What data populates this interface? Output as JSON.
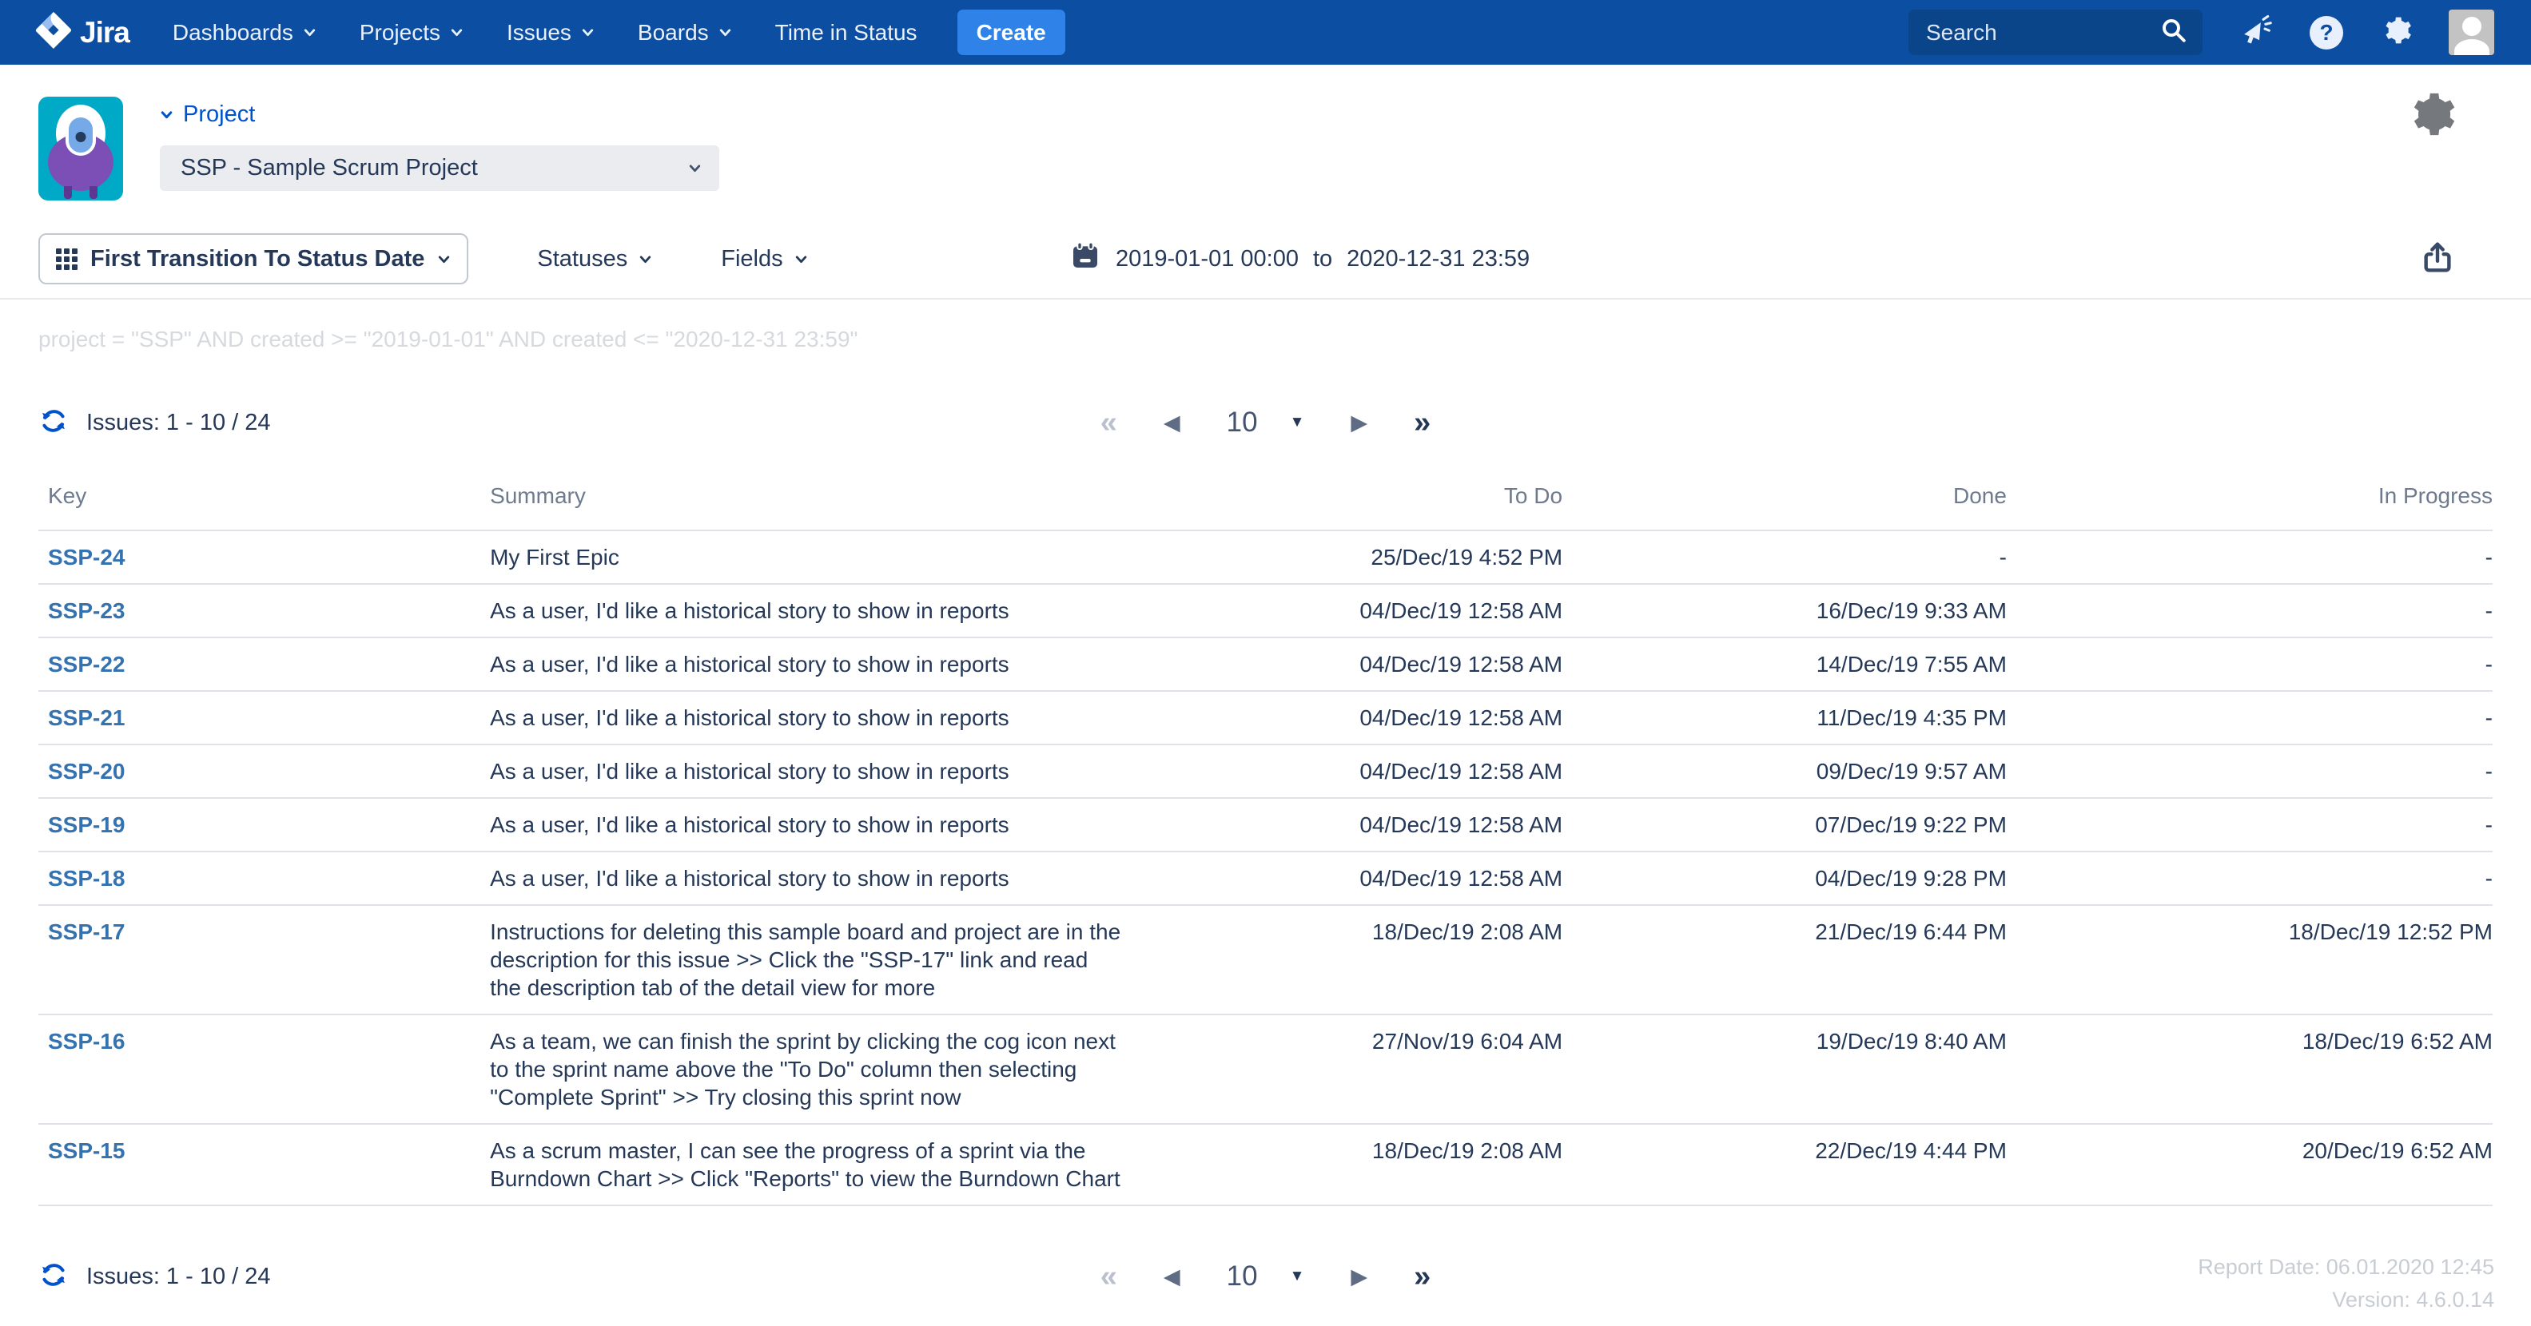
{
  "nav": {
    "brand": "Jira",
    "items": [
      {
        "label": "Dashboards"
      },
      {
        "label": "Projects"
      },
      {
        "label": "Issues"
      },
      {
        "label": "Boards"
      },
      {
        "label": "Time in Status"
      }
    ],
    "create_label": "Create",
    "search_placeholder": "Search"
  },
  "project": {
    "label": "Project",
    "selected": "SSP - Sample Scrum Project"
  },
  "toolbar": {
    "report_type": "First Transition To Status Date",
    "statuses": "Statuses",
    "fields": "Fields",
    "date_from": "2019-01-01 00:00",
    "to_word": "to",
    "date_to": "2020-12-31 23:59"
  },
  "jql": "project = \"SSP\" AND created >= \"2019-01-01\" AND created <= \"2020-12-31 23:59\"",
  "issues_bar": {
    "summary": "Issues: 1 - 10 / 24"
  },
  "pagination": {
    "page_size": "10",
    "first": "«",
    "prev": "◀",
    "next": "▶",
    "last": "»",
    "caret": "▼"
  },
  "table": {
    "columns": [
      "Key",
      "Summary",
      "To Do",
      "Done",
      "In Progress"
    ],
    "rows": [
      {
        "key": "SSP-24",
        "summary": "My First Epic",
        "todo": "25/Dec/19 4:52 PM",
        "done": "-",
        "in_progress": "-"
      },
      {
        "key": "SSP-23",
        "summary": "As a user, I'd like a historical story to show in reports",
        "todo": "04/Dec/19 12:58 AM",
        "done": "16/Dec/19 9:33 AM",
        "in_progress": "-"
      },
      {
        "key": "SSP-22",
        "summary": "As a user, I'd like a historical story to show in reports",
        "todo": "04/Dec/19 12:58 AM",
        "done": "14/Dec/19 7:55 AM",
        "in_progress": "-"
      },
      {
        "key": "SSP-21",
        "summary": "As a user, I'd like a historical story to show in reports",
        "todo": "04/Dec/19 12:58 AM",
        "done": "11/Dec/19 4:35 PM",
        "in_progress": "-"
      },
      {
        "key": "SSP-20",
        "summary": "As a user, I'd like a historical story to show in reports",
        "todo": "04/Dec/19 12:58 AM",
        "done": "09/Dec/19 9:57 AM",
        "in_progress": "-"
      },
      {
        "key": "SSP-19",
        "summary": "As a user, I'd like a historical story to show in reports",
        "todo": "04/Dec/19 12:58 AM",
        "done": "07/Dec/19 9:22 PM",
        "in_progress": "-"
      },
      {
        "key": "SSP-18",
        "summary": "As a user, I'd like a historical story to show in reports",
        "todo": "04/Dec/19 12:58 AM",
        "done": "04/Dec/19 9:28 PM",
        "in_progress": "-"
      },
      {
        "key": "SSP-17",
        "summary": "Instructions for deleting this sample board and project are in the description for this issue >> Click the \"SSP-17\" link and read the description tab of the detail view for more",
        "todo": "18/Dec/19 2:08 AM",
        "done": "21/Dec/19 6:44 PM",
        "in_progress": "18/Dec/19 12:52 PM"
      },
      {
        "key": "SSP-16",
        "summary": "As a team, we can finish the sprint by clicking the cog icon next to the sprint name above the \"To Do\" column then selecting \"Complete Sprint\" >> Try closing this sprint now",
        "todo": "27/Nov/19 6:04 AM",
        "done": "19/Dec/19 8:40 AM",
        "in_progress": "18/Dec/19 6:52 AM"
      },
      {
        "key": "SSP-15",
        "summary": "As a scrum master, I can see the progress of a sprint via the Burndown Chart >> Click \"Reports\" to view the Burndown Chart",
        "todo": "18/Dec/19 2:08 AM",
        "done": "22/Dec/19 4:44 PM",
        "in_progress": "20/Dec/19 6:52 AM"
      }
    ]
  },
  "footer": {
    "report_date": "Report Date: 06.01.2020 12:45",
    "version": "Version: 4.6.0.14"
  },
  "colors": {
    "navbar": "#0B4EA2",
    "search_bg": "#0A4489",
    "create_button": "#2E82E8",
    "key_link": "#3572B0",
    "text": "#253858",
    "muted_header": "#6E7B8F",
    "jql_text": "#D6D9DD",
    "footer_text": "#C8CDD3",
    "project_avatar_bg": "#00A9C5",
    "monster_purple": "#7B4FB5",
    "accent_blue": "#0052CC"
  }
}
